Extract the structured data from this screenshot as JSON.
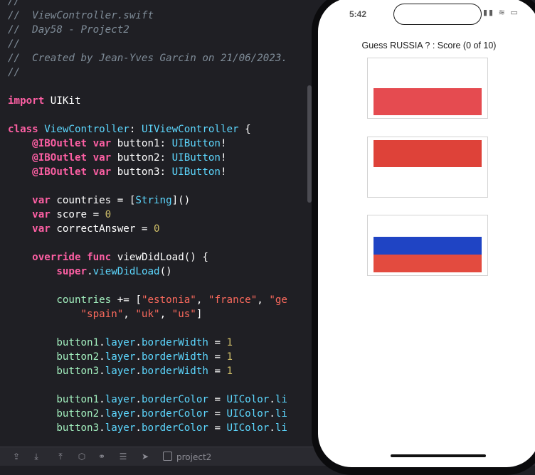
{
  "editor": {
    "lines": [
      [
        {
          "t": "//",
          "c": "comment"
        }
      ],
      [
        {
          "t": "//  ViewController.swift",
          "c": "comment"
        }
      ],
      [
        {
          "t": "//  Day58 - Project2",
          "c": "comment"
        }
      ],
      [
        {
          "t": "//",
          "c": "comment"
        }
      ],
      [
        {
          "t": "//  Created by Jean-Yves Garcin on 21/06/2023.",
          "c": "comment"
        }
      ],
      [
        {
          "t": "//",
          "c": "comment"
        }
      ],
      [],
      [
        {
          "t": "import",
          "c": "keyword"
        },
        {
          "t": " UIKit",
          "c": "plain"
        }
      ],
      [],
      [
        {
          "t": "class",
          "c": "keyword"
        },
        {
          "t": " ViewController",
          "c": "class"
        },
        {
          "t": ": ",
          "c": "plain"
        },
        {
          "t": "UIViewController",
          "c": "type"
        },
        {
          "t": " {",
          "c": "plain"
        }
      ],
      [
        {
          "t": "    ",
          "c": "plain"
        },
        {
          "t": "@IBOutlet",
          "c": "keyword"
        },
        {
          "t": " ",
          "c": "plain"
        },
        {
          "t": "var",
          "c": "keyword"
        },
        {
          "t": " button1: ",
          "c": "plain"
        },
        {
          "t": "UIButton",
          "c": "type"
        },
        {
          "t": "!",
          "c": "plain"
        }
      ],
      [
        {
          "t": "    ",
          "c": "plain"
        },
        {
          "t": "@IBOutlet",
          "c": "keyword"
        },
        {
          "t": " ",
          "c": "plain"
        },
        {
          "t": "var",
          "c": "keyword"
        },
        {
          "t": " button2: ",
          "c": "plain"
        },
        {
          "t": "UIButton",
          "c": "type"
        },
        {
          "t": "!",
          "c": "plain"
        }
      ],
      [
        {
          "t": "    ",
          "c": "plain"
        },
        {
          "t": "@IBOutlet",
          "c": "keyword"
        },
        {
          "t": " ",
          "c": "plain"
        },
        {
          "t": "var",
          "c": "keyword"
        },
        {
          "t": " button3: ",
          "c": "plain"
        },
        {
          "t": "UIButton",
          "c": "type"
        },
        {
          "t": "!",
          "c": "plain"
        }
      ],
      [],
      [
        {
          "t": "    ",
          "c": "plain"
        },
        {
          "t": "var",
          "c": "keyword"
        },
        {
          "t": " countries = [",
          "c": "plain"
        },
        {
          "t": "String",
          "c": "type"
        },
        {
          "t": "]()",
          "c": "plain"
        }
      ],
      [
        {
          "t": "    ",
          "c": "plain"
        },
        {
          "t": "var",
          "c": "keyword"
        },
        {
          "t": " score = ",
          "c": "plain"
        },
        {
          "t": "0",
          "c": "number"
        }
      ],
      [
        {
          "t": "    ",
          "c": "plain"
        },
        {
          "t": "var",
          "c": "keyword"
        },
        {
          "t": " correctAnswer = ",
          "c": "plain"
        },
        {
          "t": "0",
          "c": "number"
        }
      ],
      [],
      [
        {
          "t": "    ",
          "c": "plain"
        },
        {
          "t": "override",
          "c": "keyword"
        },
        {
          "t": " ",
          "c": "plain"
        },
        {
          "t": "func",
          "c": "keyword"
        },
        {
          "t": " viewDidLoad() {",
          "c": "plain"
        }
      ],
      [
        {
          "t": "        ",
          "c": "plain"
        },
        {
          "t": "super",
          "c": "keyword"
        },
        {
          "t": ".",
          "c": "plain"
        },
        {
          "t": "viewDidLoad",
          "c": "member2"
        },
        {
          "t": "()",
          "c": "plain"
        }
      ],
      [],
      [
        {
          "t": "        ",
          "c": "plain"
        },
        {
          "t": "countries",
          "c": "prop"
        },
        {
          "t": " += [",
          "c": "plain"
        },
        {
          "t": "\"estonia\"",
          "c": "string"
        },
        {
          "t": ", ",
          "c": "plain"
        },
        {
          "t": "\"france\"",
          "c": "string"
        },
        {
          "t": ", ",
          "c": "plain"
        },
        {
          "t": "\"ge",
          "c": "string"
        }
      ],
      [
        {
          "t": "            ",
          "c": "plain"
        },
        {
          "t": "\"spain\"",
          "c": "string"
        },
        {
          "t": ", ",
          "c": "plain"
        },
        {
          "t": "\"uk\"",
          "c": "string"
        },
        {
          "t": ", ",
          "c": "plain"
        },
        {
          "t": "\"us\"",
          "c": "string"
        },
        {
          "t": "]",
          "c": "plain"
        }
      ],
      [],
      [
        {
          "t": "        ",
          "c": "plain"
        },
        {
          "t": "button1",
          "c": "prop"
        },
        {
          "t": ".",
          "c": "plain"
        },
        {
          "t": "layer",
          "c": "member2"
        },
        {
          "t": ".",
          "c": "plain"
        },
        {
          "t": "borderWidth",
          "c": "member2"
        },
        {
          "t": " = ",
          "c": "plain"
        },
        {
          "t": "1",
          "c": "number"
        }
      ],
      [
        {
          "t": "        ",
          "c": "plain"
        },
        {
          "t": "button2",
          "c": "prop"
        },
        {
          "t": ".",
          "c": "plain"
        },
        {
          "t": "layer",
          "c": "member2"
        },
        {
          "t": ".",
          "c": "plain"
        },
        {
          "t": "borderWidth",
          "c": "member2"
        },
        {
          "t": " = ",
          "c": "plain"
        },
        {
          "t": "1",
          "c": "number"
        }
      ],
      [
        {
          "t": "        ",
          "c": "plain"
        },
        {
          "t": "button3",
          "c": "prop"
        },
        {
          "t": ".",
          "c": "plain"
        },
        {
          "t": "layer",
          "c": "member2"
        },
        {
          "t": ".",
          "c": "plain"
        },
        {
          "t": "borderWidth",
          "c": "member2"
        },
        {
          "t": " = ",
          "c": "plain"
        },
        {
          "t": "1",
          "c": "number"
        }
      ],
      [],
      [
        {
          "t": "        ",
          "c": "plain"
        },
        {
          "t": "button1",
          "c": "prop"
        },
        {
          "t": ".",
          "c": "plain"
        },
        {
          "t": "layer",
          "c": "member2"
        },
        {
          "t": ".",
          "c": "plain"
        },
        {
          "t": "borderColor",
          "c": "member2"
        },
        {
          "t": " = ",
          "c": "plain"
        },
        {
          "t": "UIColor",
          "c": "type"
        },
        {
          "t": ".",
          "c": "plain"
        },
        {
          "t": "li",
          "c": "member2"
        }
      ],
      [
        {
          "t": "        ",
          "c": "plain"
        },
        {
          "t": "button2",
          "c": "prop"
        },
        {
          "t": ".",
          "c": "plain"
        },
        {
          "t": "layer",
          "c": "member2"
        },
        {
          "t": ".",
          "c": "plain"
        },
        {
          "t": "borderColor",
          "c": "member2"
        },
        {
          "t": " = ",
          "c": "plain"
        },
        {
          "t": "UIColor",
          "c": "type"
        },
        {
          "t": ".",
          "c": "plain"
        },
        {
          "t": "li",
          "c": "member2"
        }
      ],
      [
        {
          "t": "        ",
          "c": "plain"
        },
        {
          "t": "button3",
          "c": "prop"
        },
        {
          "t": ".",
          "c": "plain"
        },
        {
          "t": "layer",
          "c": "member2"
        },
        {
          "t": ".",
          "c": "plain"
        },
        {
          "t": "borderColor",
          "c": "member2"
        },
        {
          "t": " = ",
          "c": "plain"
        },
        {
          "t": "UIColor",
          "c": "type"
        },
        {
          "t": ".",
          "c": "plain"
        },
        {
          "t": "li",
          "c": "member2"
        }
      ]
    ]
  },
  "debug_bar": {
    "icons": [
      "hide-debug-area-icon",
      "step-over-icon",
      "step-into-icon",
      "step-out-icon",
      "view-hierarchy-icon",
      "memory-graph-icon",
      "environment-overrides-icon",
      "location-icon"
    ],
    "target_label": "project2"
  },
  "simulator": {
    "status_time": "5:42",
    "status_icons": "▮▮ ≋ ▭",
    "title": "Guess RUSSIA ? : Score (0 of 10)",
    "flags": [
      {
        "name": "poland",
        "stripes": [
          {
            "color": "#ffffff"
          },
          {
            "color": "#e54b50"
          }
        ]
      },
      {
        "name": "monaco",
        "stripes": [
          {
            "color": "#de4239"
          },
          {
            "color": "#ffffff"
          }
        ]
      },
      {
        "name": "russia",
        "stripes": [
          {
            "color": "#ffffff"
          },
          {
            "color": "#1f44c4"
          },
          {
            "color": "#e34b3f"
          }
        ]
      }
    ]
  },
  "colors": {
    "editor_bg": "#1f1f24",
    "keyword": "#fc5fa3",
    "type": "#5dd8ff",
    "string": "#fc6a5d",
    "number": "#d0bf69",
    "comment": "#7f8c98"
  }
}
